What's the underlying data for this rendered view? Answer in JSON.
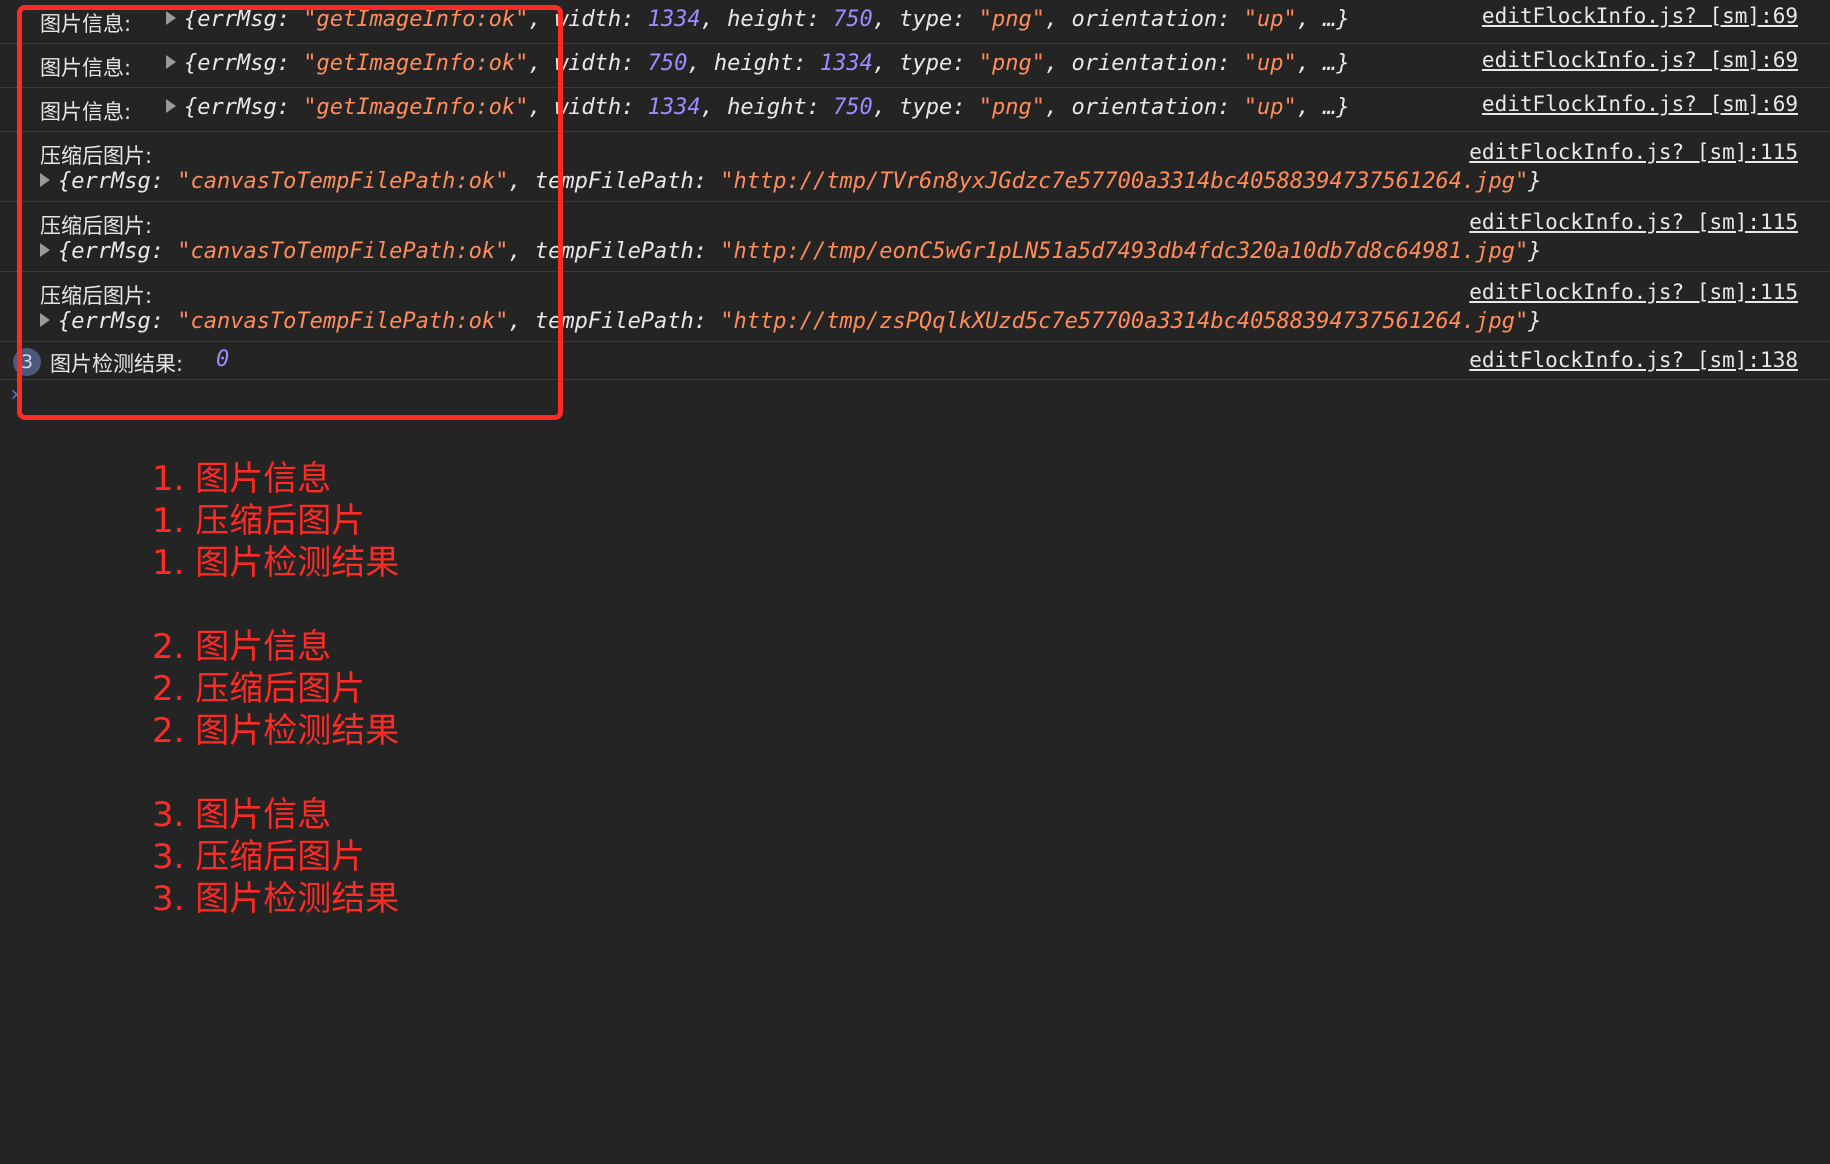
{
  "console": {
    "messages": [
      {
        "label": "图片信息:",
        "tokens": [
          {
            "t": "{",
            "c": "key"
          },
          {
            "t": "errMsg",
            "c": "key"
          },
          {
            "t": ": ",
            "c": "key"
          },
          {
            "t": "\"getImageInfo:ok\"",
            "c": "str"
          },
          {
            "t": ", width: ",
            "c": "key"
          },
          {
            "t": "1334",
            "c": "num"
          },
          {
            "t": ", height: ",
            "c": "key"
          },
          {
            "t": "750",
            "c": "num"
          },
          {
            "t": ", type: ",
            "c": "key"
          },
          {
            "t": "\"png\"",
            "c": "str"
          },
          {
            "t": ", orientation: ",
            "c": "key"
          },
          {
            "t": "\"up\"",
            "c": "str"
          },
          {
            "t": ", …}",
            "c": "key"
          }
        ],
        "source": "editFlockInfo.js? [sm]:69"
      },
      {
        "label": "图片信息:",
        "tokens": [
          {
            "t": "{",
            "c": "key"
          },
          {
            "t": "errMsg",
            "c": "key"
          },
          {
            "t": ": ",
            "c": "key"
          },
          {
            "t": "\"getImageInfo:ok\"",
            "c": "str"
          },
          {
            "t": ", width: ",
            "c": "key"
          },
          {
            "t": "750",
            "c": "num"
          },
          {
            "t": ", height: ",
            "c": "key"
          },
          {
            "t": "1334",
            "c": "num"
          },
          {
            "t": ", type: ",
            "c": "key"
          },
          {
            "t": "\"png\"",
            "c": "str"
          },
          {
            "t": ", orientation: ",
            "c": "key"
          },
          {
            "t": "\"up\"",
            "c": "str"
          },
          {
            "t": ", …}",
            "c": "key"
          }
        ],
        "source": "editFlockInfo.js? [sm]:69"
      },
      {
        "label": "图片信息:",
        "tokens": [
          {
            "t": "{",
            "c": "key"
          },
          {
            "t": "errMsg",
            "c": "key"
          },
          {
            "t": ": ",
            "c": "key"
          },
          {
            "t": "\"getImageInfo:ok\"",
            "c": "str"
          },
          {
            "t": ", width: ",
            "c": "key"
          },
          {
            "t": "1334",
            "c": "num"
          },
          {
            "t": ", height: ",
            "c": "key"
          },
          {
            "t": "750",
            "c": "num"
          },
          {
            "t": ", type: ",
            "c": "key"
          },
          {
            "t": "\"png\"",
            "c": "str"
          },
          {
            "t": ", orientation: ",
            "c": "key"
          },
          {
            "t": "\"up\"",
            "c": "str"
          },
          {
            "t": ", …}",
            "c": "key"
          }
        ],
        "source": "editFlockInfo.js? [sm]:69"
      },
      {
        "label": "压缩后图片:",
        "tokens": [
          {
            "t": "{errMsg: ",
            "c": "key"
          },
          {
            "t": "\"canvasToTempFilePath:ok\"",
            "c": "str"
          },
          {
            "t": ", tempFilePath: ",
            "c": "key"
          },
          {
            "t": "\"http://tmp/TVr6n8yxJGdzc7e57700a3314bc40588394737561264.jpg\"",
            "c": "str"
          },
          {
            "t": "}",
            "c": "key"
          }
        ],
        "source": "editFlockInfo.js? [sm]:115"
      },
      {
        "label": "压缩后图片:",
        "tokens": [
          {
            "t": "{errMsg: ",
            "c": "key"
          },
          {
            "t": "\"canvasToTempFilePath:ok\"",
            "c": "str"
          },
          {
            "t": ", tempFilePath: ",
            "c": "key"
          },
          {
            "t": "\"http://tmp/eonC5wGr1pLN51a5d7493db4fdc320a10db7d8c64981.jpg\"",
            "c": "str"
          },
          {
            "t": "}",
            "c": "key"
          }
        ],
        "source": "editFlockInfo.js? [sm]:115"
      },
      {
        "label": "压缩后图片:",
        "tokens": [
          {
            "t": "{errMsg: ",
            "c": "key"
          },
          {
            "t": "\"canvasToTempFilePath:ok\"",
            "c": "str"
          },
          {
            "t": ", tempFilePath: ",
            "c": "key"
          },
          {
            "t": "\"http://tmp/zsPQqlkXUzd5c7e57700a3314bc40588394737561264.jpg\"",
            "c": "str"
          },
          {
            "t": "}",
            "c": "key"
          }
        ],
        "source": "editFlockInfo.js? [sm]:115"
      }
    ],
    "last": {
      "badge": "3",
      "label": "图片检测结果:",
      "value": "0",
      "source": "editFlockInfo.js? [sm]:138"
    },
    "prompt_symbol": "›"
  },
  "annotation": {
    "groups": [
      [
        "1. 图片信息",
        "1. 压缩后图片",
        "1. 图片检测结果"
      ],
      [
        "2. 图片信息",
        "2. 压缩后图片",
        "2. 图片检测结果"
      ],
      [
        "3. 图片信息",
        "3. 压缩后图片",
        "3. 图片检测结果"
      ]
    ]
  },
  "colors": {
    "background": "#242424",
    "string": "#ff8c5a",
    "number": "#9d8cff",
    "annotation": "#ff2a24"
  }
}
